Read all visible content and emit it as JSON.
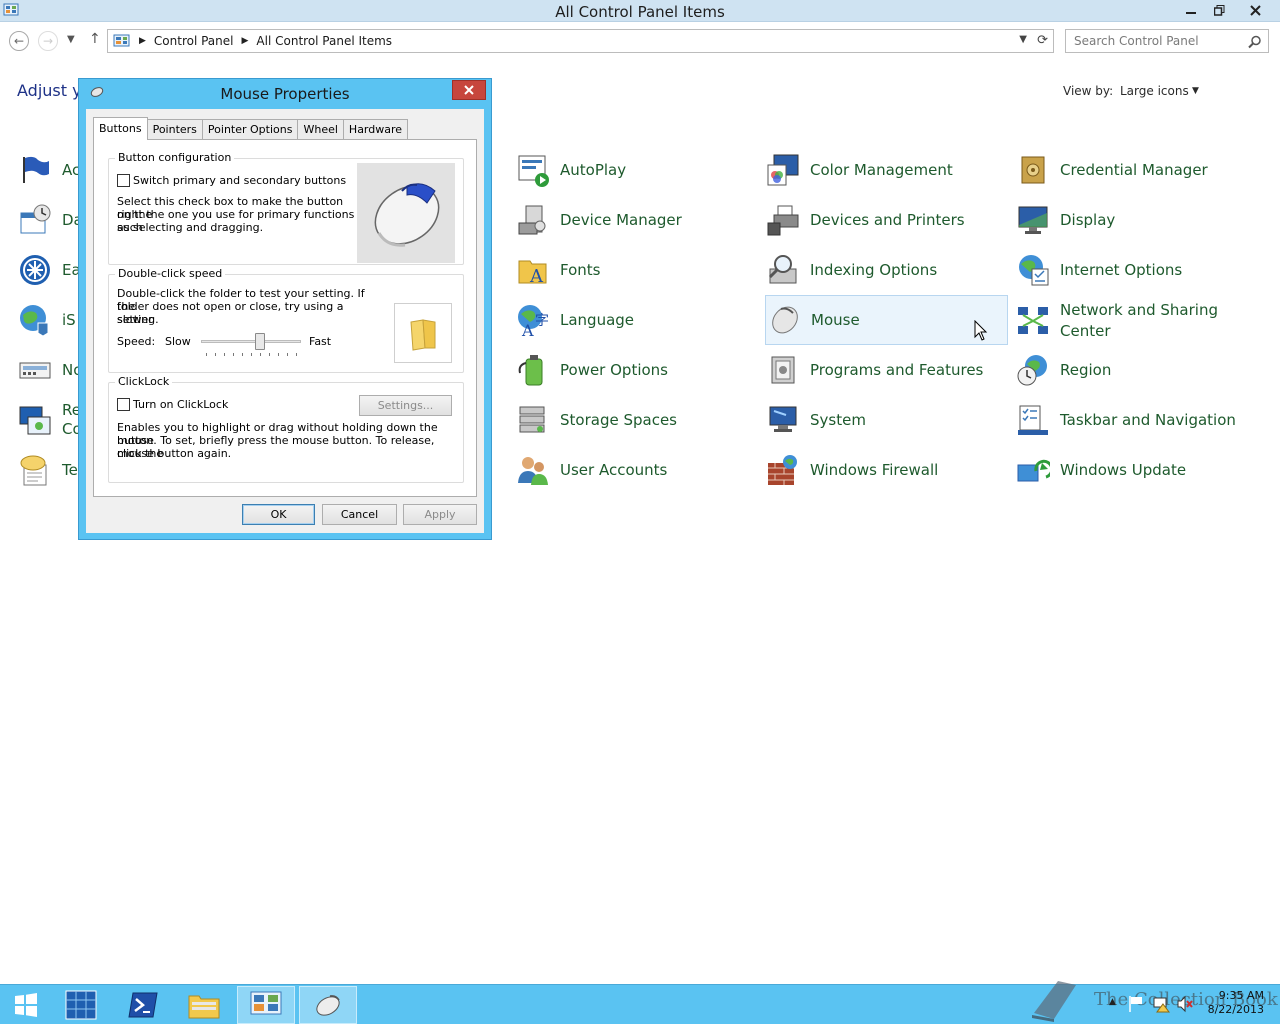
{
  "window": {
    "title": "All Control Panel Items"
  },
  "address_bar": {
    "crumbs": [
      "Control Panel",
      "All Control Panel Items"
    ],
    "search_placeholder": "Search Control Panel"
  },
  "header": {
    "adjust_text": "Adjust yo",
    "view_by_label": "View by:",
    "view_by_value": "Large icons"
  },
  "left_column_fragments": [
    "Ac",
    "Da",
    "Ea",
    "iS",
    "No",
    "Re\nCo",
    "Te"
  ],
  "items": [
    {
      "label": "AutoPlay",
      "icon": "autoplay-icon"
    },
    {
      "label": "Color Management",
      "icon": "color-management-icon"
    },
    {
      "label": "Credential Manager",
      "icon": "credential-manager-icon"
    },
    {
      "label": "Device Manager",
      "icon": "device-manager-icon"
    },
    {
      "label": "Devices and Printers",
      "icon": "devices-printers-icon"
    },
    {
      "label": "Display",
      "icon": "display-icon"
    },
    {
      "label": "Fonts",
      "icon": "fonts-icon"
    },
    {
      "label": "Indexing Options",
      "icon": "indexing-icon"
    },
    {
      "label": "Internet Options",
      "icon": "internet-options-icon"
    },
    {
      "label": "Language",
      "icon": "language-icon"
    },
    {
      "label": "Mouse",
      "icon": "mouse-icon"
    },
    {
      "label": "Network and Sharing Center",
      "icon": "network-icon"
    },
    {
      "label": "Power Options",
      "icon": "power-icon"
    },
    {
      "label": "Programs and Features",
      "icon": "programs-icon"
    },
    {
      "label": "Region",
      "icon": "region-icon"
    },
    {
      "label": "Storage Spaces",
      "icon": "storage-icon"
    },
    {
      "label": "System",
      "icon": "system-icon"
    },
    {
      "label": "Taskbar and Navigation",
      "icon": "taskbar-icon"
    },
    {
      "label": "User Accounts",
      "icon": "user-accounts-icon"
    },
    {
      "label": "Windows Firewall",
      "icon": "firewall-icon"
    },
    {
      "label": "Windows Update",
      "icon": "windows-update-icon"
    }
  ],
  "dialog": {
    "title": "Mouse Properties",
    "tabs": [
      "Buttons",
      "Pointers",
      "Pointer Options",
      "Wheel",
      "Hardware"
    ],
    "active_tab": "Buttons",
    "button_config": {
      "group_title": "Button configuration",
      "checkbox_label": "Switch primary and secondary buttons",
      "description": [
        "Select this check box to make the button on the",
        "right the one you use for primary functions such",
        "as selecting and dragging."
      ]
    },
    "double_click": {
      "group_title": "Double-click speed",
      "description": [
        "Double-click the folder to test your setting. If the",
        "folder does not open or close, try using a slower",
        "setting."
      ],
      "speed_label": "Speed:",
      "slow_label": "Slow",
      "fast_label": "Fast",
      "slider_value": 0.6
    },
    "clicklock": {
      "group_title": "ClickLock",
      "checkbox_label": "Turn on ClickLock",
      "settings_label": "Settings...",
      "description": [
        "Enables you to highlight or drag without holding down the mouse",
        "button. To set, briefly press the mouse button. To release, click the",
        "mouse button again."
      ]
    },
    "ok_label": "OK",
    "cancel_label": "Cancel",
    "apply_label": "Apply"
  },
  "taskbar": {
    "time": "9:35 AM",
    "date": "8/22/2013",
    "watermark": "The Collection Book"
  },
  "colors": {
    "accent": "#5ac3f2",
    "link_green": "#1e5a2d",
    "close_red": "#c7463d"
  }
}
